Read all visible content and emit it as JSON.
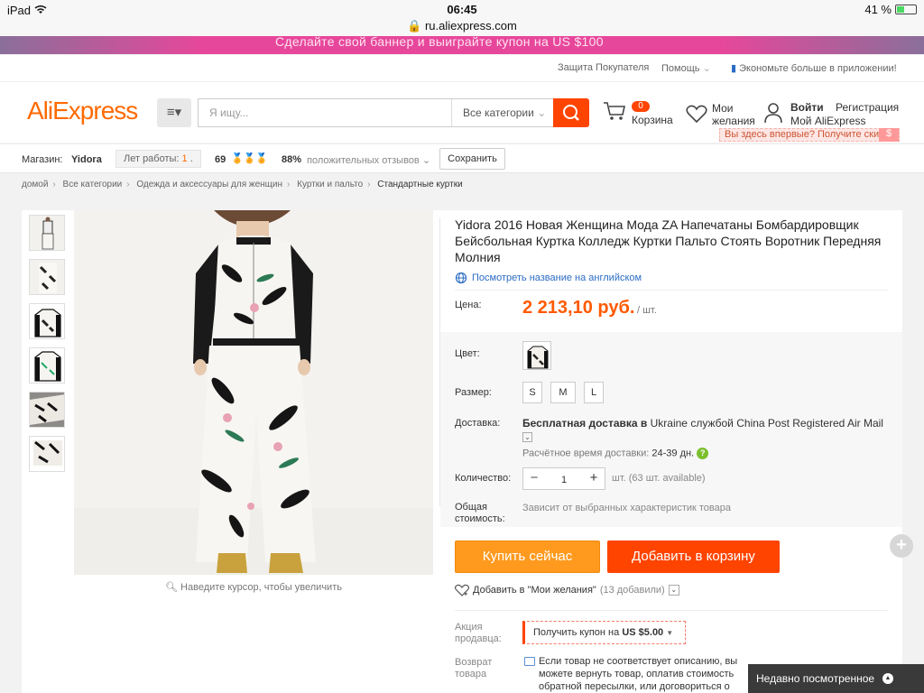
{
  "status_bar": {
    "device": "iPad",
    "time": "06:45",
    "url": "ru.aliexpress.com",
    "battery": "41 %",
    "battery_level": 0.41
  },
  "banner": {
    "text": "Сделайте свой баннер и выиграйте купон на US $100"
  },
  "top_links": {
    "protection": "Защита Покупателя",
    "help": "Помощь",
    "app": "Экономьте больше в приложении!"
  },
  "header": {
    "logo": "AliExpress",
    "search_placeholder": "Я ищу...",
    "search_category": "Все категории",
    "cart_count": "0",
    "cart_label": "Корзина",
    "wish_label_1": "Мои",
    "wish_label_2": "желания",
    "login": "Войти",
    "register": "Регистрация",
    "my_account": "Мой AliExpress",
    "new_here": "Вы здесь впервые? Получите ски...",
    "new_here_badge": "$"
  },
  "store": {
    "label": "Магазин:",
    "name": "Yidora",
    "years_label": "Лет работы:",
    "years_value": "1",
    "years_suffix": ".",
    "rating": "69",
    "medals": "🏅🏅🏅",
    "positive_pct": "88%",
    "positive_label": "положительных отзывов",
    "save": "Сохранить"
  },
  "breadcrumb": [
    "домой",
    "Все категории",
    "Одежда и аксессуары для женщин",
    "Куртки и пальто",
    "Стандартные куртки"
  ],
  "product": {
    "title": "Yidora 2016 Новая Женщина Мода ZA Напечатаны Бомбардировщик Бейсбольная Куртка Колледж Куртки Пальто Стоять Воротник Передняя Молния",
    "translate": "Посмотреть название на английском",
    "price_label": "Цена:",
    "price": "2 213,10 руб.",
    "price_unit": "/ шт.",
    "color_label": "Цвет:",
    "size_label": "Размер:",
    "sizes": [
      "S",
      "M",
      "L"
    ],
    "shipping_label": "Доставка:",
    "shipping_prefix": "Бесплатная доставка в",
    "shipping_country": "Ukraine",
    "shipping_mid": "службой",
    "shipping_method": "China Post Registered Air Mail",
    "delivery_label": "Расчётное время доставки:",
    "delivery_value": "24-39 дн.",
    "quantity_label": "Количество:",
    "quantity": "1",
    "quantity_note": "шт. (63 шт. available)",
    "total_label_1": "Общая",
    "total_label_2": "стоимость:",
    "total_note": "Зависит от выбранных характеристик товара",
    "buy_now": "Купить сейчас",
    "add_to_cart": "Добавить в корзину",
    "add_wish": "Добавить в \"Мои желания\"",
    "wish_count": "(13 добавили)",
    "promo_label_1": "Акция",
    "promo_label_2": "продавца:",
    "coupon_prefix": "Получить купон на",
    "coupon_value": "US $5.00",
    "return_label_1": "Возврат",
    "return_label_2": "товара",
    "return_text": "Если товар не соответствует описанию, вы можете вернуть товар, оплатив стоимость обратной пересылки, или договориться о компенсации с продавцом. У",
    "zoom_hint": "Наведите курсор, чтобы увеличить"
  },
  "recent": {
    "label": "Недавно посмотренное"
  },
  "colors": {
    "accent": "#ff4400",
    "orange": "#ff9a1e",
    "price": "#ff5a00",
    "link": "#2b6cc4"
  }
}
